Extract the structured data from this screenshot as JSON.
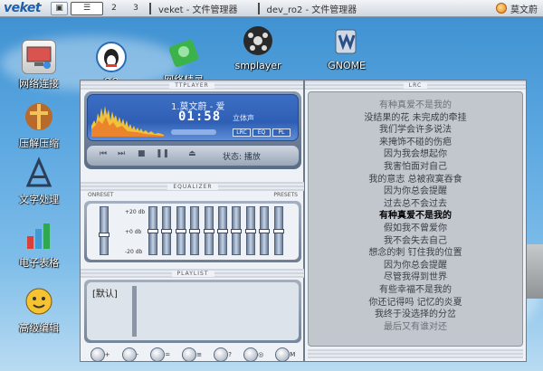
{
  "taskbar": {
    "logo": "veket",
    "workspaces": [
      "2",
      "3"
    ],
    "tasks": [
      "veket - 文件管理器",
      "dev_ro2 - 文件管理器"
    ],
    "user": "莫文蔚"
  },
  "desktop": {
    "icons": [
      {
        "name": "network",
        "label": "网络连接",
        "icon": "network-icon"
      },
      {
        "name": "qq",
        "label": "QQ",
        "icon": "qq-penguin-icon"
      },
      {
        "name": "network-pet",
        "label": "网络精灵",
        "icon": "network-pet-icon"
      },
      {
        "name": "smplayer",
        "label": "smplayer",
        "icon": "smplayer-film-icon"
      },
      {
        "name": "gnome",
        "label": "GNOME",
        "icon": "gnome-mug-icon"
      },
      {
        "name": "archive",
        "label": "压解压缩",
        "icon": "archive-icon"
      },
      {
        "name": "text",
        "label": "文字处理",
        "icon": "text-editor-icon"
      },
      {
        "name": "spreadsheet",
        "label": "电子表格",
        "icon": "spreadsheet-icon"
      },
      {
        "name": "advanced-edit",
        "label": "高级编辑",
        "icon": "advanced-editor-icon"
      }
    ]
  },
  "player": {
    "title": "TTPLAYER",
    "song": "1.莫文蔚 - 爱",
    "time": "01:58",
    "stereo": "立体声",
    "modes": [
      "LRC",
      "EQ",
      "PL"
    ],
    "status": "状态: 播放",
    "eq_title": "EQUALIZER",
    "eq_on": "ON",
    "eq_reset": "RESET",
    "eq_presets": "PRESETS",
    "eq_scale": [
      "+20 db",
      "+0 db",
      "-20 db"
    ],
    "eq_levels": [
      0.42,
      0.5,
      0.5,
      0.5,
      0.5,
      0.5,
      0.5,
      0.5,
      0.5,
      0.5,
      0.5
    ],
    "playlist_title": "PLAYLIST",
    "playlist_default": "[默认]",
    "playlist_buttons": [
      "+",
      "-",
      "=",
      "≡",
      "?",
      "◎",
      "M"
    ]
  },
  "lrc": {
    "title": "LRC",
    "lines": [
      "有种真爱不是我的",
      "没结果的花 未完成的牵挂",
      "我们学会许多说法",
      "来掩饰不碰的伤疤",
      "因为我会想起你",
      "我害怕面对自己",
      "我的意志 总被寂寞吞食",
      "因为你总会提醒",
      "过去总不会过去",
      "有种真爱不是我的",
      "假如我不曾爱你",
      "我不会失去自己",
      "想念的刺 钉住我的位置",
      "因为你总会提醒",
      "尽管我得到世界",
      "有些幸福不是我的",
      "你还记得吗 记忆的炎夏",
      "我终于没选择的分岔",
      "最后又有谁对还"
    ],
    "current_index": 9
  }
}
